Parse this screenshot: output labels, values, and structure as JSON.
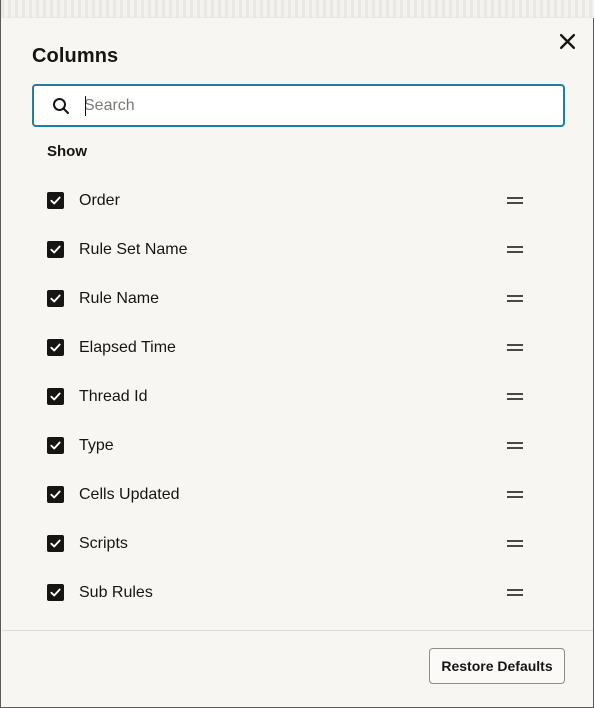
{
  "dialog": {
    "title": "Columns",
    "close_icon": "close-icon"
  },
  "search": {
    "placeholder": "Search",
    "value": "",
    "icon": "search-icon"
  },
  "section": {
    "label": "Show"
  },
  "columns": [
    {
      "label": "Order",
      "checked": true
    },
    {
      "label": "Rule Set Name",
      "checked": true
    },
    {
      "label": "Rule Name",
      "checked": true
    },
    {
      "label": "Elapsed Time",
      "checked": true
    },
    {
      "label": "Thread Id",
      "checked": true
    },
    {
      "label": "Type",
      "checked": true
    },
    {
      "label": "Cells Updated",
      "checked": true
    },
    {
      "label": "Scripts",
      "checked": true
    },
    {
      "label": "Sub Rules",
      "checked": true
    }
  ],
  "footer": {
    "restore_label": "Restore Defaults"
  },
  "colors": {
    "focus_border": "#227e9e",
    "checkbox_fill": "#161513",
    "background": "#f8f6f3"
  }
}
